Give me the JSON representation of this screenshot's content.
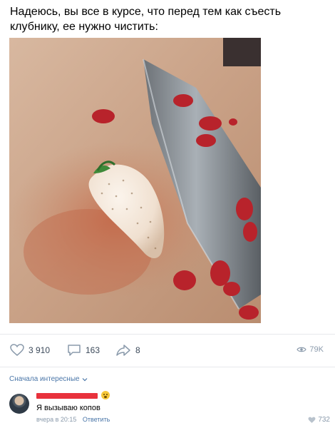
{
  "post": {
    "text": "Надеюсь, вы все в курсе, что перед тем как съесть клубнику, ее нужно чистить:"
  },
  "actions": {
    "likes": "3 910",
    "comments": "163",
    "shares": "8",
    "views": "79K"
  },
  "comments_section": {
    "sort_label": "Сначала интересные",
    "items": [
      {
        "text": "Я вызываю копов",
        "time": "вчера в 20:15",
        "reply_label": "Ответить",
        "likes": "732"
      }
    ]
  },
  "icons": {
    "like": "heart-icon",
    "comment": "comment-icon",
    "share": "share-icon",
    "views": "eye-icon",
    "sort": "chevron-down-icon"
  },
  "colors": {
    "link": "#4a76a8",
    "muted": "#8a9aab",
    "action": "#3c4a5a",
    "redaction": "#e8323c"
  }
}
